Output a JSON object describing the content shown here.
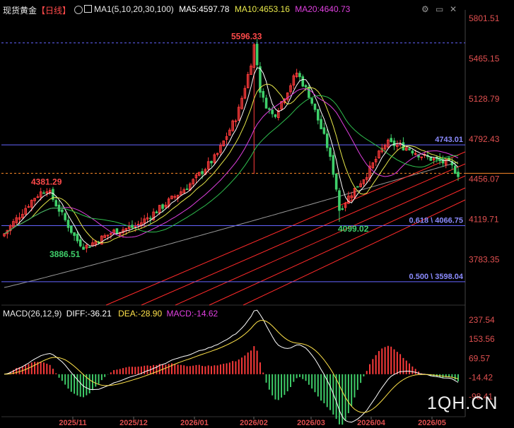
{
  "header": {
    "symbol": "现货黄金",
    "period": "【日线】",
    "ma_label": "MA1(5,10,20,30,100)",
    "ma5": "MA5:4597.78",
    "ma10": "MA10:4653.16",
    "ma20": "MA20:4640.73"
  },
  "macd_header": {
    "params": "MACD(26,12,9)",
    "diff": "DIFF:-36.21",
    "dea": "DEA:-28.90",
    "macd": "MACD:-14.62"
  },
  "watermark": "1QH.CN",
  "colors": {
    "background": "#000000",
    "up": "#ff3b3b",
    "down": "#3fcf6a",
    "ma5": "#ffffff",
    "ma10": "#e8e84a",
    "ma20": "#e040e0",
    "ma30": "#2fbf4f",
    "ma100": "#9a9a9a",
    "fib_line": "#6464ff",
    "trend_line": "#ff2a2a",
    "current_price_line": "#ff8a2a",
    "macd_diff": "#ffffff",
    "macd_dea": "#ffe24a"
  },
  "icons": [
    "gear-icon",
    "restore-window-icon",
    "close-icon",
    "chart-toggle-icon"
  ],
  "chart_data": [
    {
      "type": "candlestick",
      "price_axis_ticks": [
        5801.51,
        5465.15,
        5128.79,
        4792.43,
        4456.07,
        4119.71,
        3783.35
      ],
      "price_axis_tick_labels": [
        "5801.51",
        "5465.15",
        "5128.79",
        "4792.43",
        "4456.07",
        "4119.71",
        "3783.35"
      ],
      "ylim": [
        3550,
        5860
      ],
      "x_tick_labels": [
        "2025/11",
        "2025/12",
        "2026/01",
        "2026/02",
        "2026/03",
        "2026/04",
        "2026/05"
      ],
      "annotations": [
        {
          "text": "5596.33",
          "price": 5596.33,
          "kind": "high"
        },
        {
          "text": "4381.29",
          "price": 4381.29,
          "kind": "high"
        },
        {
          "text": "3886.51",
          "price": 3886.51,
          "kind": "low"
        },
        {
          "text": "4099.02",
          "price": 4099.02,
          "kind": "low"
        }
      ],
      "horizontal_levels": [
        {
          "price": 5596.33,
          "style": "dashed",
          "color": "#6464ff"
        },
        {
          "price": 4743.01,
          "text": "4743.01",
          "style": "solid",
          "color": "#6464ff"
        },
        {
          "price": 4066.75,
          "text": "0.618 \\ 4066.75",
          "style": "solid",
          "color": "#6464ff"
        },
        {
          "price": 3598.04,
          "text": "0.500 \\ 3598.04",
          "style": "solid",
          "color": "#6464ff"
        },
        {
          "price": 4505,
          "style": "dashed",
          "color": "#ff8a2a"
        }
      ],
      "trend_channel_line_count": 5,
      "key_path": [
        {
          "month": "2025/10-late",
          "price": 4000
        },
        {
          "month": "2025/10-peak",
          "price": 4381.29
        },
        {
          "month": "2025/11-low",
          "price": 3886.51
        },
        {
          "month": "2025/12-end",
          "price": 4480
        },
        {
          "month": "2026/01-end",
          "price": 5596.33
        },
        {
          "month": "2026/02",
          "price": 5350
        },
        {
          "month": "2026/03-low",
          "price": 4099.02
        },
        {
          "month": "2026/04",
          "price": 4760
        },
        {
          "month": "2026/05",
          "price": 4500
        }
      ],
      "series": [
        {
          "name": "MA5",
          "value": 4597.78
        },
        {
          "name": "MA10",
          "value": 4653.16
        },
        {
          "name": "MA20",
          "value": 4640.73
        }
      ]
    },
    {
      "type": "macd",
      "axis_ticks": [
        237.54,
        153.56,
        69.57,
        -14.42,
        -98.41
      ],
      "axis_tick_labels": [
        "237.54",
        "153.56",
        "69.57",
        "-14.42",
        "-98.41"
      ],
      "ylim": [
        -170,
        270
      ],
      "series": [
        {
          "name": "DIFF",
          "value": -36.21
        },
        {
          "name": "DEA",
          "value": -28.9
        },
        {
          "name": "MACD",
          "value": -14.62
        }
      ]
    }
  ]
}
